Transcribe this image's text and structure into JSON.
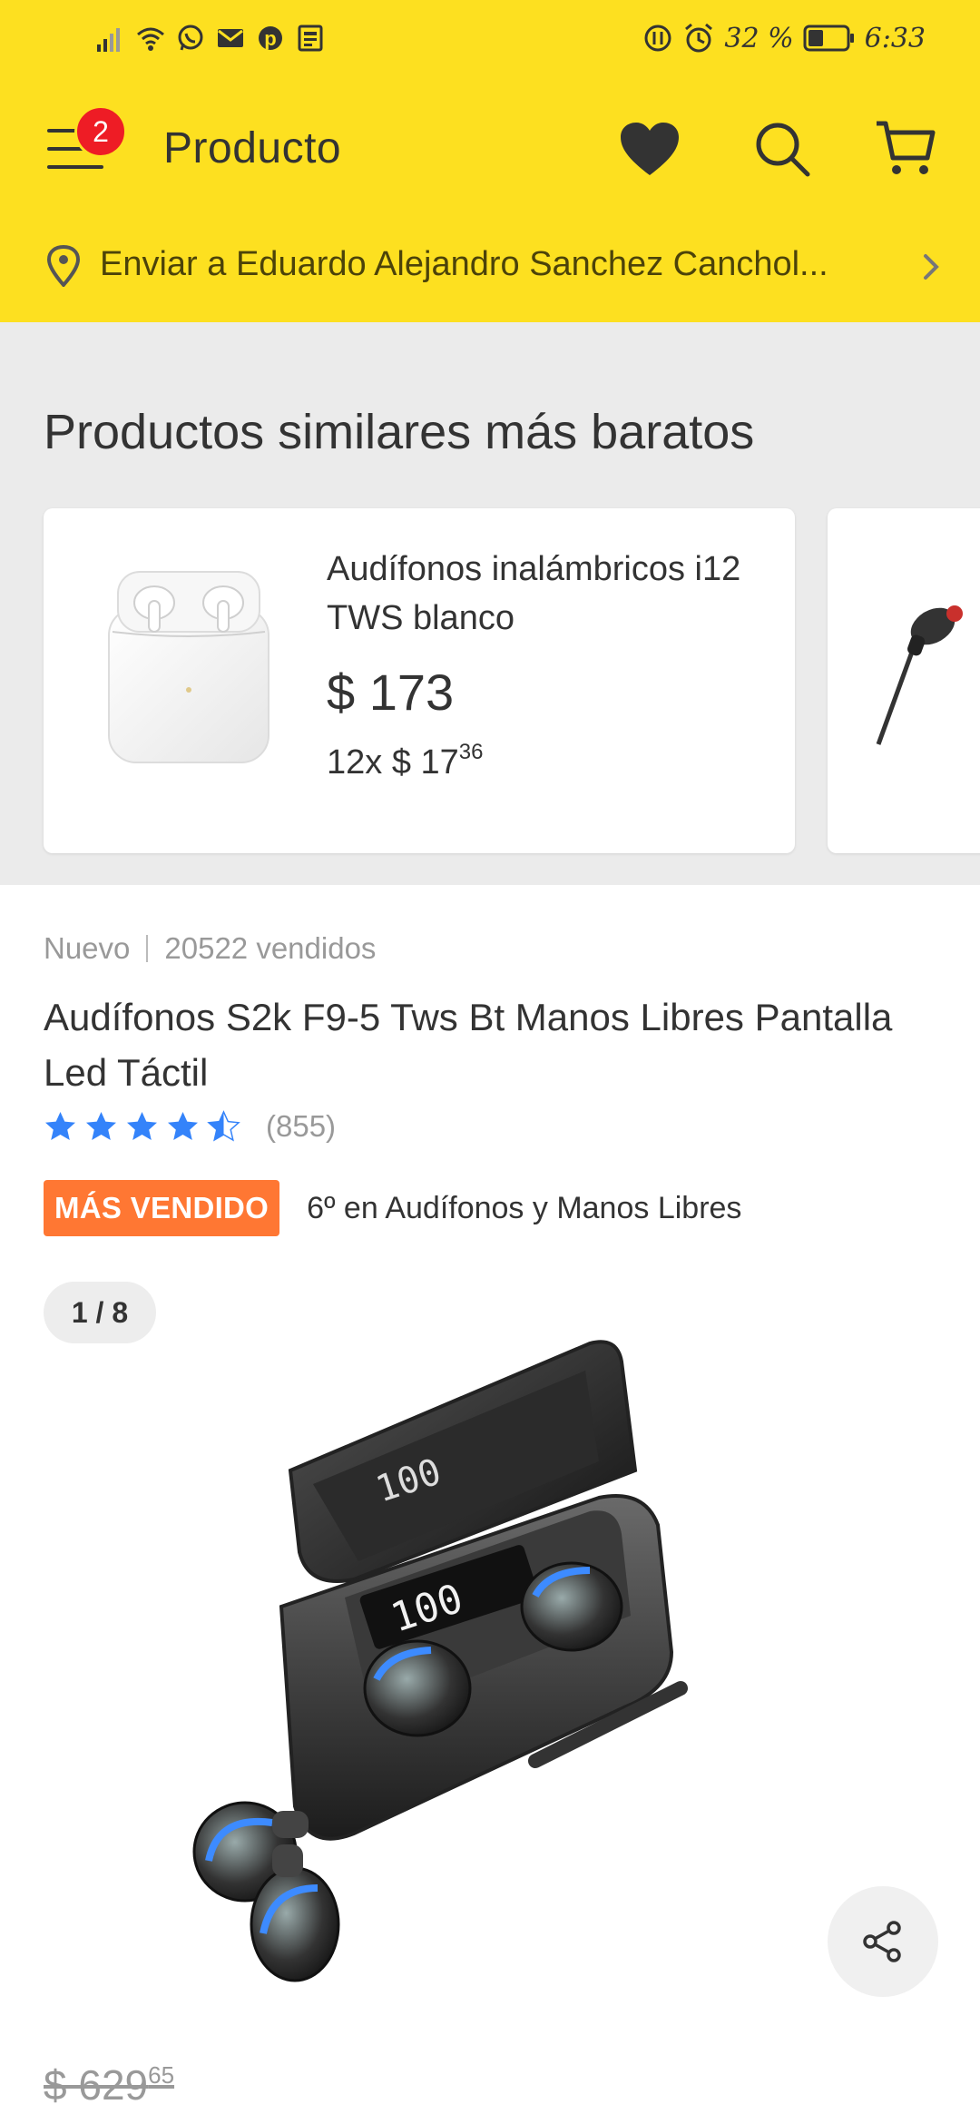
{
  "status_bar": {
    "battery": "32 %",
    "time": "6:33"
  },
  "header": {
    "menu_badge": "2",
    "title": "Producto"
  },
  "shipping": {
    "text": "Enviar a Eduardo Alejandro Sanchez Canchol..."
  },
  "similar": {
    "title": "Productos similares más baratos",
    "card": {
      "name": "Audífonos inalámbricos i12 TWS blanco",
      "price": "$ 173",
      "installments_prefix": "12x $ 17",
      "installments_cents": "36"
    }
  },
  "product": {
    "condition": "Nuevo",
    "sold": "20522 vendidos",
    "title": "Audífonos S2k F9-5 Tws Bt Manos Libres Pantalla Led Táctil",
    "rating_value": 4.5,
    "rating_count": "(855)",
    "badge": "MÁS VENDIDO",
    "ranking": "6º en Audífonos y Manos Libres",
    "gallery_counter": "1 / 8",
    "screen_text": "100",
    "old_price": "$ 629",
    "old_price_cents": "65"
  },
  "colors": {
    "brand_yellow": "#fde020",
    "badge_orange": "#ff7733",
    "star_blue": "#3483fa",
    "notification_red": "#ee1c25"
  },
  "icons": {
    "menu": "hamburger-icon",
    "favorites": "heart-icon",
    "search": "search-icon",
    "cart": "cart-icon",
    "location": "location-pin-icon",
    "chevron": "chevron-right-icon",
    "share": "share-icon"
  }
}
